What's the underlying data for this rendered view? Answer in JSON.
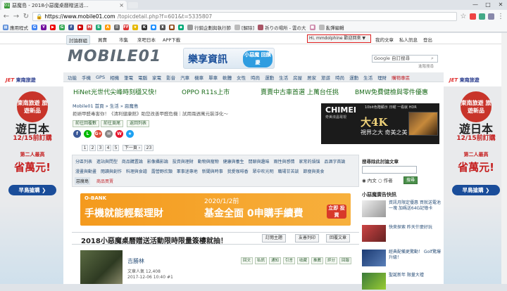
{
  "browser": {
    "tab_title": "惡魔島 - 2018小惡魔桌曆贈送活...",
    "url_host": "https://www.mobile01.com",
    "url_path": "/topicdetail.php?f=601&t=5335807",
    "bookmarks": [
      "應用程式",
      "G",
      "Y",
      "▶",
      "G",
      "f",
      "▶",
      "M",
      "S",
      "A",
      "☰",
      "FF",
      "★",
      "K",
      "●",
      "♜",
      "■",
      "◆",
      "行銷企劃與執行節",
      "[解除]",
      "祈りの場所 - 雲の大",
      "■",
      "亂彈編輯"
    ],
    "window_controls": [
      "—",
      "□",
      "✕"
    ]
  },
  "site": {
    "topnav": [
      "討論群組",
      "買賣",
      "市集",
      "來吧日本",
      "APP下載"
    ],
    "user_greeting": "Hi, mmdolphine 歡迎回來 ▼",
    "user_links": [
      "我的文章",
      "私人訊息",
      "登出"
    ],
    "logo": "MOBILE01",
    "top_ad_main": "樂享資訊",
    "top_ad_badge": "小惡魔 回饋慶",
    "search_placeholder": "Google 自訂搜尋",
    "search_link": "進階搜尋",
    "categories": [
      "手機",
      "GPS",
      "相機",
      "筆電",
      "電腦",
      "家電",
      "影音",
      "汽車",
      "機車",
      "單車",
      "軟體",
      "女性",
      "時尚",
      "運動",
      "生活",
      "房屋",
      "居家",
      "旅遊",
      "時尚",
      "運動",
      "生活",
      "理財"
    ],
    "categories_first": "功能",
    "categories_hot": "購物專區",
    "ad_links": [
      "HiNet光世代尖峰時刻穩又快!",
      "OPPO R11s上市",
      "賣賣中古車首選 上萬台任挑",
      "BMW免費健檢與零件優惠"
    ]
  },
  "left_ad": {
    "brand": "東南旅遊",
    "badge": "東南旅遊 旅遊新品",
    "headline": "遊日本",
    "date": "12/15前訂購",
    "sub": "第二人最高",
    "amount": "省萬元!",
    "cta": "早鳥搶購 ❯"
  },
  "right_ad": {
    "brand": "東南旅遊",
    "badge": "東南旅遊 旅遊新品",
    "headline": "遊日本",
    "date": "12/15前訂購",
    "sub": "第二人最高",
    "amount": "省萬元!",
    "cta": "早鳥搶購 ❯"
  },
  "post_header": {
    "breadcrumb": "Mobile01 首頁 » 生活 » 惡魔島",
    "subtext": "拒絕甲醛毒害你！《清利健康館》助您改善甲醛危機｜試用兩週萬元裝淨化～",
    "pills": [
      "前往回覆數",
      "前往頁尾",
      "返回列表"
    ],
    "social": [
      "f",
      "L",
      "G+",
      "✉",
      "W",
      "★"
    ],
    "pages": [
      "1",
      "2",
      "3",
      "4",
      "5",
      "下一頁 ›",
      "23"
    ]
  },
  "chimei_ad": {
    "brand": "CHIMEI",
    "brand_sub": "奇美液晶電視",
    "top_text": "10bit色階顯示 日曜 一看就 HDR",
    "main": "大4K",
    "tagline": "視界之大 奇美之美"
  },
  "forum_categories": {
    "row1": [
      "分區列表",
      "進站與問型",
      "商品購置論",
      "影像攝影論",
      "投資與理財",
      "動物與寵物",
      "健康與養生",
      "閒聊與趣味",
      "兩性與感情",
      "家常的煩惱",
      "品酒字首論"
    ],
    "row2": [
      "漫畫與動畫",
      "閱讀與創作",
      "料理與食譜",
      "露營野炊類",
      "軍事迷專地",
      "新聞與時事",
      "我愛咖啡香",
      "眾中吹光明",
      "職場甘苦談",
      "節瘦與美食"
    ],
    "selected": "惡魔島",
    "hot": "商品買賣"
  },
  "banner_ad": {
    "brand": "O-BANK",
    "main_left": "手機就能輕鬆理財",
    "date": "2020/1/2前",
    "main_right": "基金全面 0申購手續費",
    "cta": "立即 投資"
  },
  "post": {
    "title": "2018小惡魔桌曆贈送活動限時限量簽樓就抽！",
    "buttons": [
      "訂閱主題",
      "友善列印",
      "回覆文章"
    ],
    "author": "吉勝林",
    "views": "文章人氣 12,408",
    "date": "2017-12-06 10:40 #1",
    "actions": [
      "回文",
      "私訊",
      "通知",
      "引言",
      "收藏",
      "推薦",
      "評分",
      "回報"
    ]
  },
  "sidebar": {
    "search_title": "搜尋除此討論文章",
    "radio_options": [
      "◉ 內文",
      "○ 作者"
    ],
    "search_button": "搜尋",
    "news_title": "小惡魔廣告快訊",
    "news": [
      {
        "text": "資訊月限定優惠 買就送電池一塊 加碼送64G記憶卡"
      },
      {
        "text": "快來探索 昨天什麼好玩"
      },
      {
        "text": "經典配備更驚動！ Golf驚爆升級！"
      },
      {
        "text": "聖誕新年 限量大禮"
      }
    ]
  },
  "colors": {
    "accent": "#3a9a3a",
    "link": "#2a4f78",
    "hot": "#c0222a",
    "highlight_border": "#e02020"
  }
}
